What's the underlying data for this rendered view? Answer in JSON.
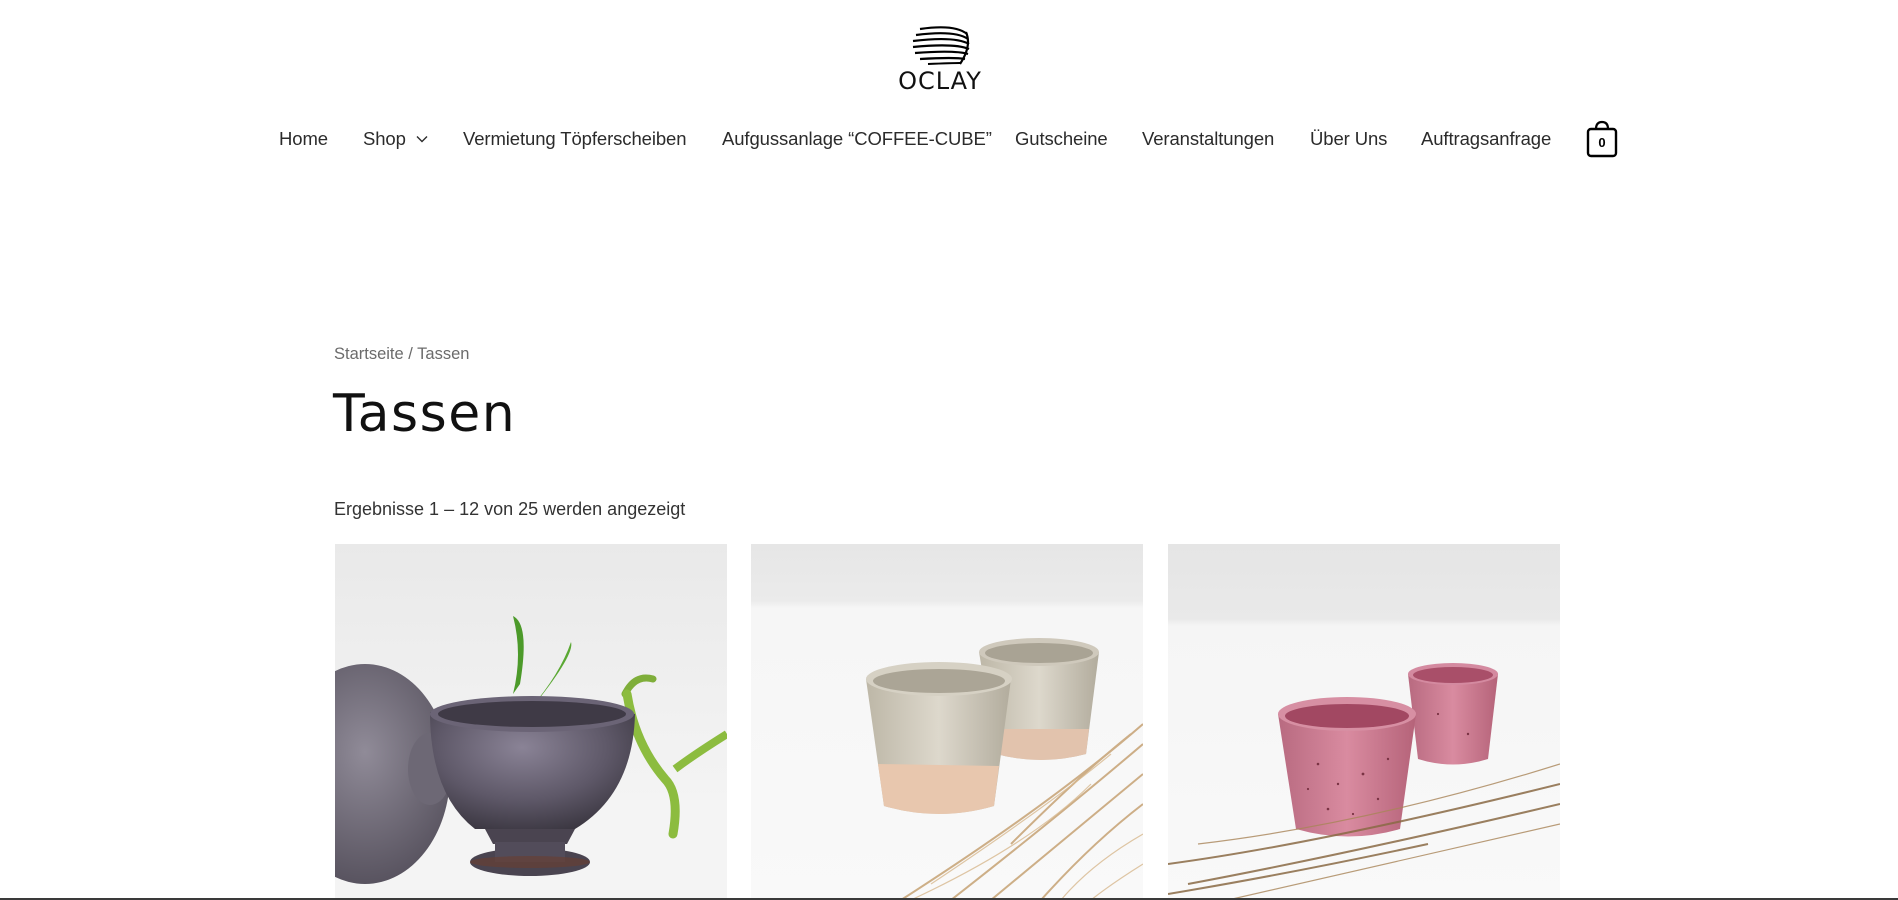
{
  "brand": {
    "name": "OCLAY"
  },
  "nav": {
    "items": [
      {
        "label": "Home"
      },
      {
        "label": "Shop"
      },
      {
        "label": "Vermietung Töpferscheiben"
      },
      {
        "label": "Aufgussanlage “COFFEE-CUBE”"
      },
      {
        "label": "Gutscheine"
      },
      {
        "label": "Veranstaltungen"
      },
      {
        "label": "Über Uns"
      },
      {
        "label": "Auftragsanfrage"
      }
    ],
    "cart_count": "0"
  },
  "breadcrumb": {
    "home": "Startseite",
    "separator": " / ",
    "current": "Tassen"
  },
  "page": {
    "title": "Tassen",
    "result_count": "Ergebnisse 1 – 12 von 25 werden angezeigt"
  },
  "products": [
    {
      "image": "grey-glazed-footed-cup-with-bamboo"
    },
    {
      "image": "two-beige-tumblers-with-dried-grass"
    },
    {
      "image": "two-pink-speckled-tumblers-with-dried-grass"
    }
  ],
  "colors": {
    "text": "#222222",
    "muted": "#6b6b6b",
    "background": "#ffffff"
  }
}
